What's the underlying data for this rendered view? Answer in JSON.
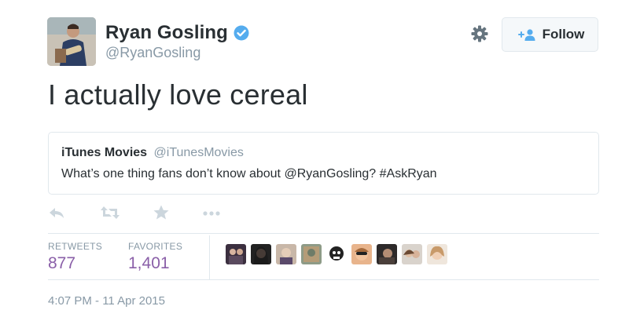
{
  "author": {
    "display_name": "Ryan Gosling",
    "handle": "@RyanGosling",
    "verified": true
  },
  "header": {
    "follow_label": "Follow",
    "gear_icon": "gear-icon"
  },
  "tweet": {
    "text": "I actually love cereal"
  },
  "quote": {
    "name": "iTunes Movies",
    "handle": "@iTunesMovies",
    "text": "What’s one thing fans don’t know about @RyanGosling? #AskRyan"
  },
  "actions": [
    "reply-icon",
    "retweet-icon",
    "favorite-icon",
    "more-icon"
  ],
  "stats": {
    "retweets_label": "RETWEETS",
    "retweets_value": "877",
    "favorites_label": "FAVORITES",
    "favorites_value": "1,401"
  },
  "timestamp": "4:07 PM - 11 Apr 2015",
  "colors": {
    "verified": "#55acee",
    "stat_value": "#8a5fa8",
    "muted": "#8899a6",
    "border": "#e1e8ed"
  }
}
